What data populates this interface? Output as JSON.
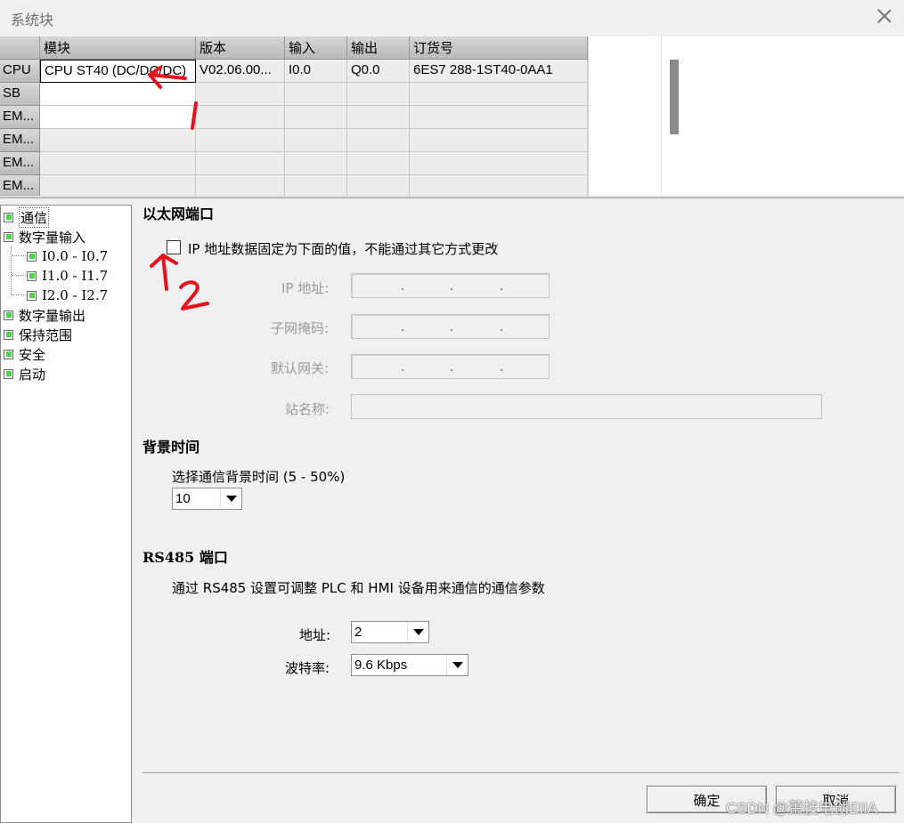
{
  "window": {
    "title": "系统块"
  },
  "grid": {
    "headers": [
      "模块",
      "版本",
      "输入",
      "输出",
      "订货号"
    ],
    "rows": [
      {
        "slot": "CPU",
        "module": "CPU ST40 (DC/DC/DC)",
        "version": "V02.06.00...",
        "input": "I0.0",
        "output": "Q0.0",
        "order": "6ES7 288-1ST40-0AA1"
      },
      {
        "slot": "SB",
        "module": "",
        "version": "",
        "input": "",
        "output": "",
        "order": ""
      },
      {
        "slot": "EM...",
        "module": "",
        "version": "",
        "input": "",
        "output": "",
        "order": ""
      },
      {
        "slot": "EM...",
        "module": "",
        "version": "",
        "input": "",
        "output": "",
        "order": ""
      },
      {
        "slot": "EM...",
        "module": "",
        "version": "",
        "input": "",
        "output": "",
        "order": ""
      },
      {
        "slot": "EM...",
        "module": "",
        "version": "",
        "input": "",
        "output": "",
        "order": ""
      }
    ]
  },
  "tree": {
    "items": [
      {
        "label": "通信"
      },
      {
        "label": "数字量输入"
      },
      {
        "label": "I0.0 - I0.7"
      },
      {
        "label": "I1.0 - I1.7"
      },
      {
        "label": "I2.0 - I2.7"
      },
      {
        "label": "数字量输出"
      },
      {
        "label": "保持范围"
      },
      {
        "label": "安全"
      },
      {
        "label": "启动"
      }
    ]
  },
  "ethernet": {
    "title": "以太网端口",
    "checkbox_label": "IP 地址数据固定为下面的值，不能通过其它方式更改",
    "checked": false,
    "ip_label": "IP 地址:",
    "subnet_label": "子网掩码:",
    "gateway_label": "默认网关:",
    "station_label": "站名称:"
  },
  "background": {
    "title": "背景时间",
    "label": "选择通信背景时间 (5 - 50%)",
    "value": "10"
  },
  "rs485": {
    "title": "RS485  端口",
    "description": "通过 RS485 设置可调整 PLC 和 HMI 设备用来通信的通信参数",
    "address_label": "地址:",
    "address_value": "2",
    "baud_label": "波特率:",
    "baud_value": "9.6 Kbps"
  },
  "buttons": {
    "ok": "确定",
    "cancel": "取消"
  },
  "watermark": "CSDN @萧技电创EIIA",
  "annotations": {
    "mark1": "1",
    "mark2": "2",
    "color": "#e8101a"
  }
}
